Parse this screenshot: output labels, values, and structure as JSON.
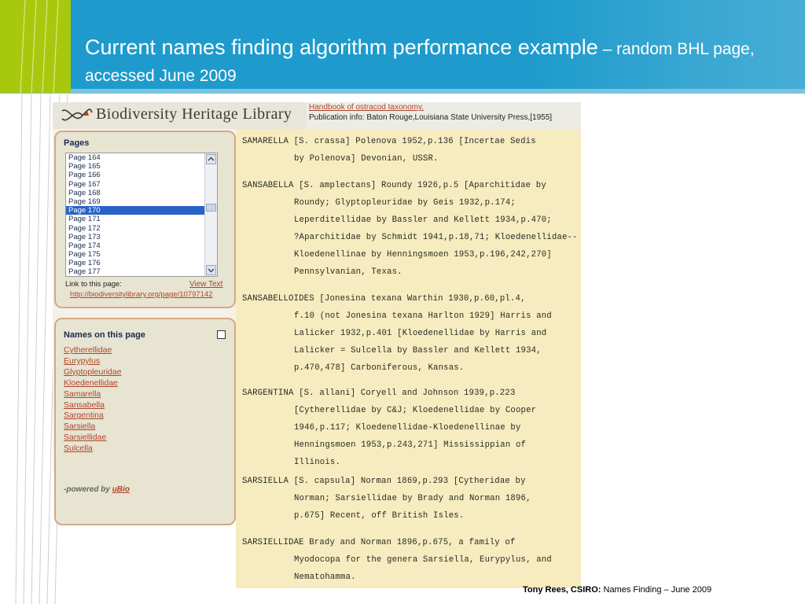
{
  "slide": {
    "title_main": "Current names finding algorithm performance example",
    "title_sub": " – random BHL page, accessed June 2009"
  },
  "colors": {
    "header_blue": "#1e9bcc",
    "accent_lime": "#a8c80e",
    "link_red": "#b0452a",
    "selected_blue": "#2864c8"
  },
  "bhl": {
    "logo_text": "Biodiversity Heritage Library",
    "pub_title": "Handbook of ostracod taxonomy.",
    "pub_info": "Publication info: Baton Rouge,Louisiana State University Press,[1955]",
    "pages_title": "Pages",
    "pages": [
      "Page 164",
      "Page 165",
      "Page 166",
      "Page 167",
      "Page 168",
      "Page 169",
      "Page 170",
      "Page 171",
      "Page 172",
      "Page 173",
      "Page 174",
      "Page 175",
      "Page 176",
      "Page 177"
    ],
    "selected_page": "Page 170",
    "link_label": "Link to this page:",
    "view_text": "View Text",
    "permalink": "http://biodiversitylibrary.org/page/10797142",
    "names_title": "Names on this page",
    "names": [
      "Cytherellidae",
      "Eurypylus",
      "Glyptopleuridae",
      "Kloedenellidae",
      "Samarella",
      "Sansabella",
      "Sargentina",
      "Sarsiella",
      "Sarsiellidae",
      "Sulcella"
    ],
    "powered_by": "-powered by ",
    "powered_link": "uBio"
  },
  "document_lines": [
    "SAMARELLA [S. crassa] Polenova 1952,p.136 [Incertae Sedis",
    "by Polenova] Devonian, USSR.",
    "SANSABELLA [S. amplectans] Roundy 1926,p.5 [Aparchitidae by",
    "Roundy; Glyptopleuridae by Geis 1932,p.174;",
    "Leperditellidae by Bassler and Kellett 1934,p.470;",
    "?Aparchitidae by Schmidt 1941,p.18,71; Kloedenellidae--",
    "Kloedenellinae by Henningsmoen 1953,p.196,242,270]",
    "Pennsylvanian, Texas.",
    "SANSABELLOIDES [Jonesina texana Warthin 1930,p.60,pl.4,",
    "f.10 (not Jonesina texana Harlton 1929] Harris and",
    "Lalicker 1932,p.401 [Kloedenellidae by Harris and",
    "Lalicker = Sulcella by Bassler and Kellett 1934,",
    "p.470,478] Carboniferous, Kansas.",
    "SARGENTINA [S. allani] Coryell and Johnson 1939,p.223",
    "[Cytherellidae by C&J; Kloedenellidae by Cooper",
    "1946,p.117; Kloedenellidae-Kloedenellinae by",
    "Henningsmoen 1953,p.243,271] Mississippian of",
    "Illinois.",
    "SARSIELLA [S. capsula] Norman 1869,p.293 [Cytheridae by",
    "Norman; Sarsiellidae by Brady and Norman 1896,",
    "p.675] Recent, off British Isles.",
    "SARSIELLIDAE Brady and Norman 1896,p.675, a family of",
    "Myodocopa for the genera Sarsiella, Eurypylus, and",
    "Nematohamma."
  ],
  "footer": {
    "author": "Tony Rees, CSIRO:",
    "rest": " Names Finding – June 2009"
  }
}
